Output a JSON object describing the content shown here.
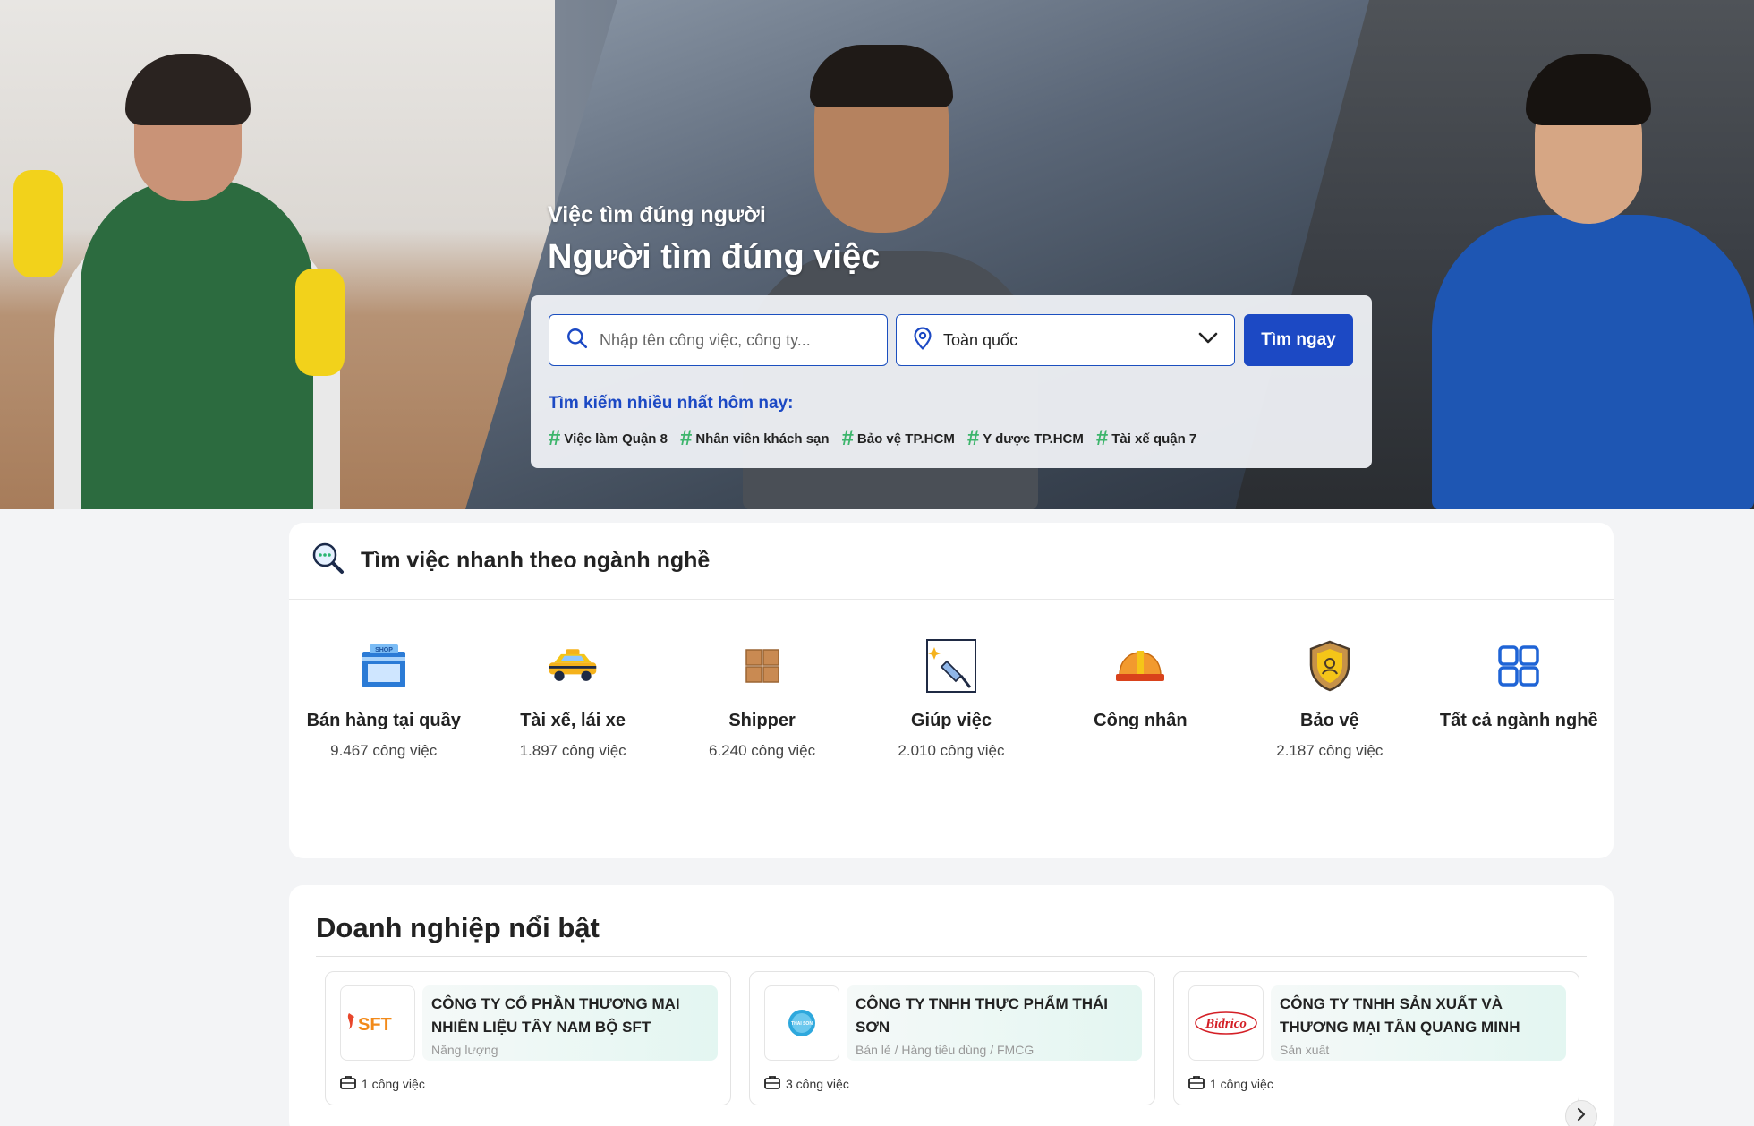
{
  "hero": {
    "tagline": "Việc tìm đúng người",
    "headline": "Người tìm đúng việc"
  },
  "search": {
    "placeholder": "Nhập tên công việc, công ty...",
    "location": "Toàn quốc",
    "button_label": "Tìm ngay",
    "trending_title": "Tìm kiếm nhiều nhất hôm nay:",
    "trending_tags": [
      "Việc làm Quận 8",
      "Nhân viên khách sạn",
      "Bảo vệ TP.HCM",
      "Y dược TP.HCM",
      "Tài xế quận 7"
    ]
  },
  "categories": {
    "title": "Tìm việc nhanh theo ngành nghề",
    "items": [
      {
        "name": "Bán hàng tại quầy",
        "count": "9.467 công việc",
        "icon": "shop-icon"
      },
      {
        "name": "Tài xế, lái xe",
        "count": "1.897 công việc",
        "icon": "taxi-icon"
      },
      {
        "name": "Shipper",
        "count": "6.240 công việc",
        "icon": "boxes-icon"
      },
      {
        "name": "Giúp việc",
        "count": "2.010 công việc",
        "icon": "cleaning-icon"
      },
      {
        "name": "Công nhân",
        "count": "",
        "icon": "hardhat-icon"
      },
      {
        "name": "Bảo vệ",
        "count": "2.187 công việc",
        "icon": "shield-icon"
      },
      {
        "name": "Tất cả ngành nghề",
        "count": "",
        "icon": "grid-icon"
      }
    ]
  },
  "companies": {
    "title": "Doanh nghiệp nổi bật",
    "items": [
      {
        "name": "CÔNG TY CỔ PHẦN THƯƠNG MẠI NHIÊN LIỆU TÂY NAM BỘ SFT",
        "industry": "Năng lượng",
        "jobs": "1 công việc",
        "logo": "SFT"
      },
      {
        "name": "CÔNG TY TNHH THỰC PHẨM THÁI SƠN",
        "industry": "Bán lẻ / Hàng tiêu dùng / FMCG",
        "jobs": "3 công việc",
        "logo": "THAI SON"
      },
      {
        "name": "CÔNG TY TNHH SẢN XUẤT VÀ THƯƠNG MẠI TÂN QUANG MINH",
        "industry": "Sản xuất",
        "jobs": "1 công việc",
        "logo": "Bidrico"
      }
    ]
  },
  "colors": {
    "primary": "#1c49c4",
    "tag_hash": "#3db56c",
    "icon_blue": "#1f64d6",
    "icon_orange": "#f29a2e"
  }
}
